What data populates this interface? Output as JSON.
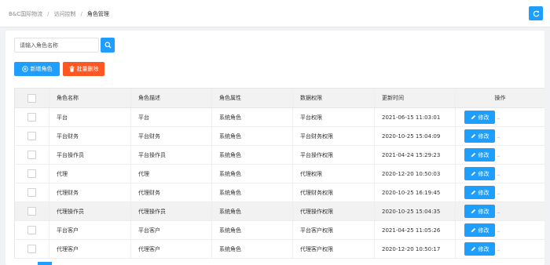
{
  "breadcrumb": {
    "items": [
      "B&C国际物流",
      "访问控制",
      "角色管理"
    ],
    "separator": "/"
  },
  "search": {
    "placeholder": "请输入角色名称",
    "value": ""
  },
  "toolbar": {
    "add_label": "新增角色",
    "batch_delete_label": "批量删除"
  },
  "table": {
    "columns": [
      "角色名称",
      "角色描述",
      "角色属性",
      "数据权限",
      "更新时间",
      "操作"
    ],
    "edit_label": "修改",
    "more_label": "...",
    "rows": [
      {
        "name": "平台",
        "desc": "平台",
        "attr": "系统角色",
        "perm": "平台权限",
        "time": "2021-06-15 11:03:01"
      },
      {
        "name": "平台财务",
        "desc": "平台财务",
        "attr": "系统角色",
        "perm": "平台财务权限",
        "time": "2020-10-25 15:04:09"
      },
      {
        "name": "平台操作员",
        "desc": "平台操作员",
        "attr": "系统角色",
        "perm": "平台操作权限",
        "time": "2021-04-24 15:29:23"
      },
      {
        "name": "代理",
        "desc": "代理",
        "attr": "系统角色",
        "perm": "代理权限",
        "time": "2020-12-20 10:50:03"
      },
      {
        "name": "代理财务",
        "desc": "代理财务",
        "attr": "系统角色",
        "perm": "代理财务权限",
        "time": "2020-10-25 16:19:45"
      },
      {
        "name": "代理操作员",
        "desc": "代理操作员",
        "attr": "系统角色",
        "perm": "代理操作权限",
        "time": "2020-10-25 15:04:35"
      },
      {
        "name": "平台客户",
        "desc": "平台客户",
        "attr": "系统角色",
        "perm": "平台客户权限",
        "time": "2021-04-25 11:05:26"
      },
      {
        "name": "代理客户",
        "desc": "代理客户",
        "attr": "系统角色",
        "perm": "代理客户权限",
        "time": "2020-12-20 10:50:17"
      }
    ],
    "highlighted_row": 5
  },
  "colors": {
    "primary": "#1e9fff",
    "danger": "#ff5722"
  },
  "icons": {
    "refresh": "refresh-icon",
    "search": "search-icon",
    "add": "plus-circle-icon",
    "delete": "trash-icon",
    "edit": "pencil-icon"
  }
}
